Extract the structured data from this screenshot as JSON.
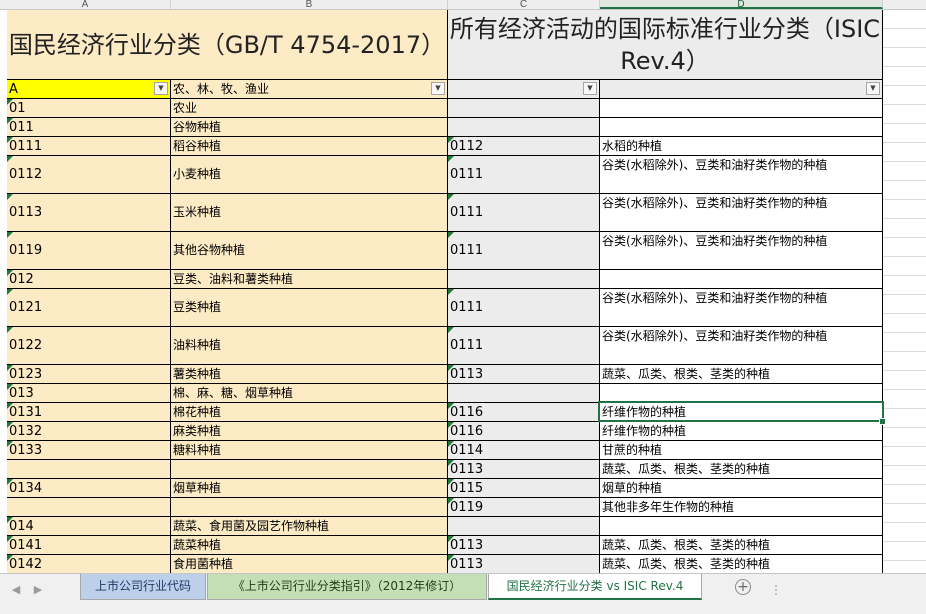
{
  "columns": [
    "A",
    "B",
    "C",
    "D"
  ],
  "titles": {
    "left": "国民经济行业分类（GB/T 4754-2017）",
    "right": "所有经济活动的国际标准行业分类（ISIC Rev.4）"
  },
  "filter_row": {
    "a": "A",
    "b": "农、林、牧、渔业",
    "c": "",
    "d": ""
  },
  "rows": [
    {
      "a": "01",
      "b": "农业",
      "c": "",
      "d": ""
    },
    {
      "a": "011",
      "b": "谷物种植",
      "c": "",
      "d": ""
    },
    {
      "a": "0111",
      "b": "稻谷种植",
      "c": "0112",
      "d": "水稻的种植"
    },
    {
      "a": "0112",
      "b": "小麦种植",
      "c": "0111",
      "d": "谷类(水稻除外)、豆类和油籽类作物的种植"
    },
    {
      "a": "0113",
      "b": "玉米种植",
      "c": "0111",
      "d": "谷类(水稻除外)、豆类和油籽类作物的种植"
    },
    {
      "a": "0119",
      "b": "其他谷物种植",
      "c": "0111",
      "d": "谷类(水稻除外)、豆类和油籽类作物的种植"
    },
    {
      "a": "012",
      "b": "豆类、油料和薯类种植",
      "c": "",
      "d": ""
    },
    {
      "a": "0121",
      "b": "豆类种植",
      "c": "0111",
      "d": "谷类(水稻除外)、豆类和油籽类作物的种植"
    },
    {
      "a": "0122",
      "b": "油料种植",
      "c": "0111",
      "d": "谷类(水稻除外)、豆类和油籽类作物的种植"
    },
    {
      "a": "0123",
      "b": "薯类种植",
      "c": "0113",
      "d": "蔬菜、瓜类、根类、茎类的种植"
    },
    {
      "a": "013",
      "b": "棉、麻、糖、烟草种植",
      "c": "",
      "d": ""
    },
    {
      "a": "0131",
      "b": "棉花种植",
      "c": "0116",
      "d": "纤维作物的种植"
    },
    {
      "a": "0132",
      "b": "麻类种植",
      "c": "0116",
      "d": "纤维作物的种植"
    },
    {
      "a": "0133",
      "b": "糖料种植",
      "c": "0114",
      "d": "甘蔗的种植"
    },
    {
      "a": "",
      "b": "",
      "c": "0113",
      "d": "蔬菜、瓜类、根类、茎类的种植"
    },
    {
      "a": "0134",
      "b": "烟草种植",
      "c": "0115",
      "d": "烟草的种植"
    },
    {
      "a": "",
      "b": "",
      "c": "0119",
      "d": "其他非多年生作物的种植"
    },
    {
      "a": "014",
      "b": "蔬菜、食用菌及园艺作物种植",
      "c": "",
      "d": ""
    },
    {
      "a": "0141",
      "b": "蔬菜种植",
      "c": "0113",
      "d": "蔬菜、瓜类、根类、茎类的种植"
    },
    {
      "a": "0142",
      "b": "食用菌种植",
      "c": "0113",
      "d": "蔬菜、瓜类、根类、茎类的种植"
    }
  ],
  "sheet_tabs": [
    {
      "label": "上市公司行业代码",
      "style": "blue"
    },
    {
      "label": "《上市公司行业分类指引》（2012年修订）",
      "style": "green"
    },
    {
      "label": "国民经济行业分类 vs ISIC Rev.4",
      "style": "active"
    }
  ],
  "add_sheet_label": "+",
  "nav_prev": "◀",
  "nav_next": "▶",
  "more_tabs": "⋮",
  "filter_arrow": "▼",
  "colors": {
    "tan": "#fdebc6",
    "gray": "#ececec",
    "yellow": "#ffff00",
    "excel_green": "#217346"
  }
}
